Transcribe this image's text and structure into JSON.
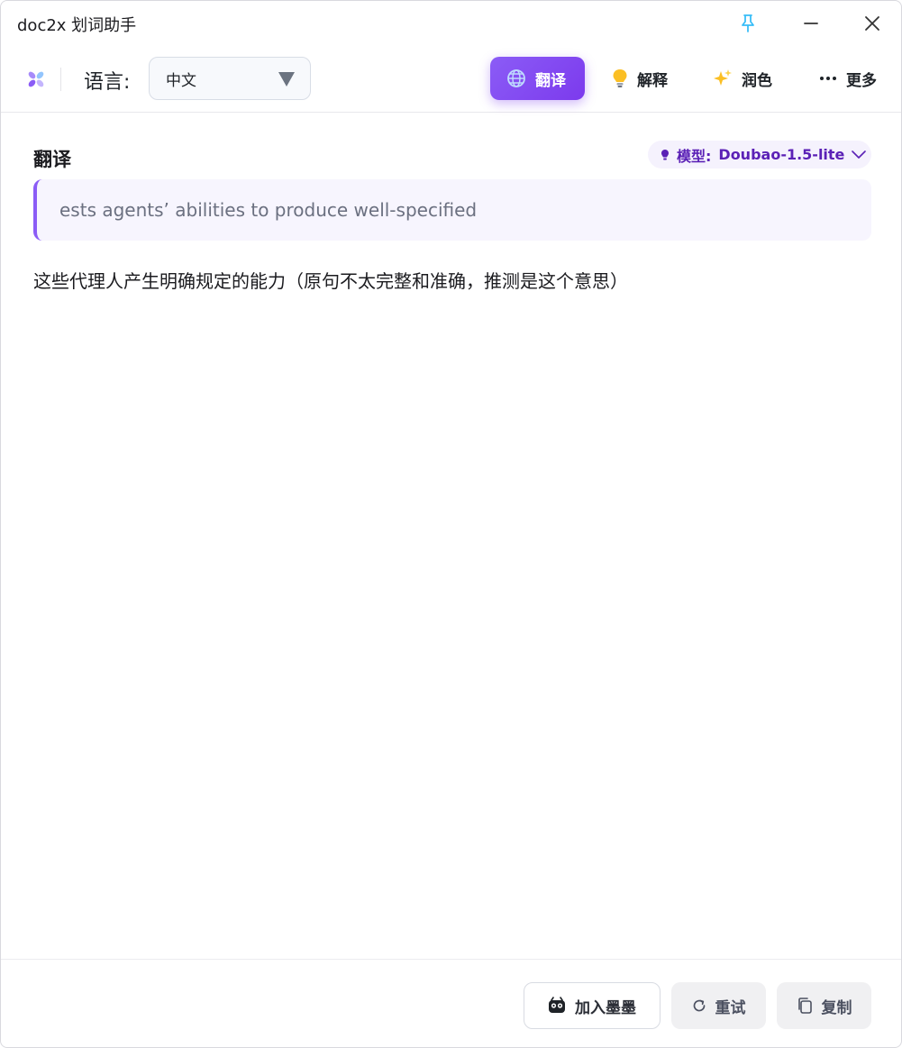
{
  "window": {
    "title": "doc2x 划词助手"
  },
  "toolbar": {
    "language_label": "语言:",
    "language_value": "中文",
    "actions": {
      "translate": "翻译",
      "explain": "解释",
      "polish": "润色",
      "more": "更多"
    }
  },
  "content": {
    "section_title": "翻译",
    "model_label": "模型:",
    "model_value": "Doubao-1.5-lite",
    "source_text": "ests agents’  abilities to produce well-specified",
    "result_text": "这些代理人产生明确规定的能力（原句不太完整和准确，推测是这个意思）"
  },
  "footer": {
    "add_label": "加入墨墨",
    "retry_label": "重试",
    "copy_label": "复制"
  },
  "colors": {
    "accent": "#7c3aed",
    "accent_light": "#f7f5fe",
    "model_text": "#5b21b6"
  }
}
